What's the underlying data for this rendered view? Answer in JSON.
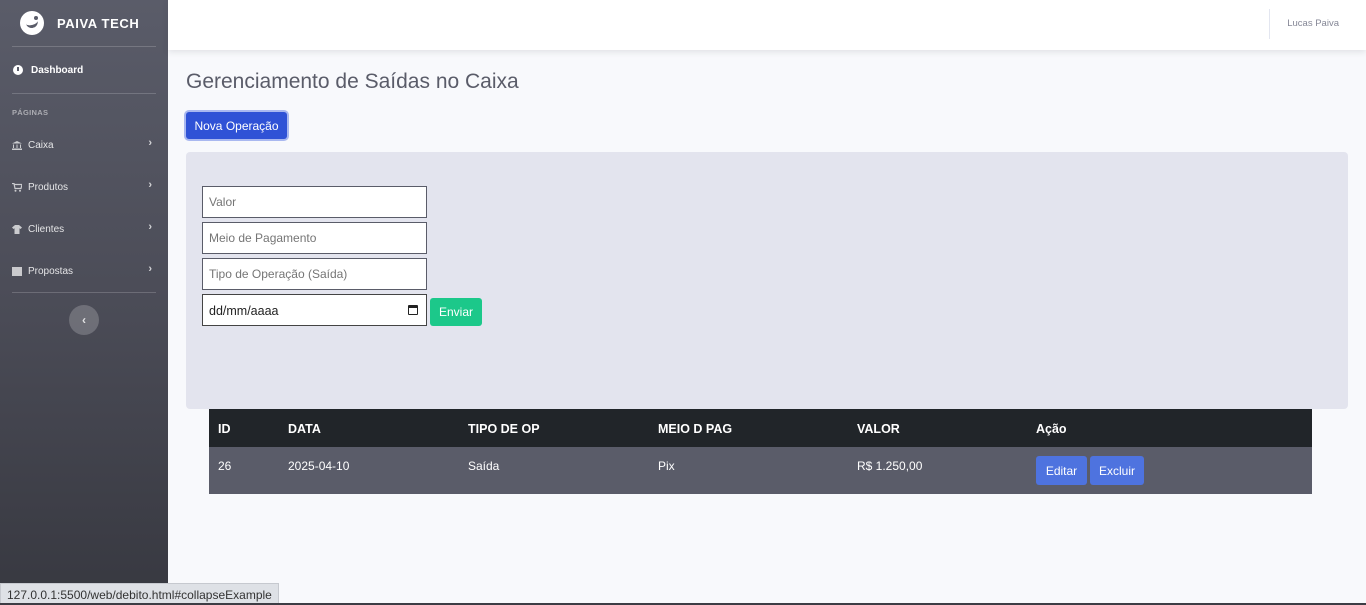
{
  "brand": {
    "name": "PAIVA TECH",
    "icon": "laugh-wink-icon"
  },
  "sidebar": {
    "dashboard": {
      "label": "Dashboard",
      "icon": "tachometer-icon"
    },
    "heading": "PÁGINAS",
    "items": [
      {
        "label": "Caixa",
        "icon": "university-icon"
      },
      {
        "label": "Produtos",
        "icon": "shopping-cart-icon"
      },
      {
        "label": "Clientes",
        "icon": "shirt-icon"
      },
      {
        "label": "Propostas",
        "icon": "table-icon"
      }
    ],
    "toggle_icon": "chevron-left-icon"
  },
  "topbar": {
    "user": "Lucas Paiva"
  },
  "page": {
    "title": "Gerenciamento de Saídas no Caixa",
    "new_button": "Nova Operação"
  },
  "form": {
    "valor_placeholder": "Valor",
    "meio_placeholder": "Meio de Pagamento",
    "tipo_placeholder": "Tipo de Operação (Saída)",
    "date_placeholder": "dd/mm/aaaa",
    "submit": "Enviar"
  },
  "table": {
    "headers": [
      "ID",
      "DATA",
      "TIPO DE OP",
      "MEIO D PAG",
      "VALOR",
      "Ação"
    ],
    "rows": [
      {
        "id": "26",
        "data": "2025-04-10",
        "tipo": "Saída",
        "meio": "Pix",
        "valor": "R$ 1.250,00",
        "edit": "Editar",
        "delete": "Excluir"
      }
    ]
  },
  "status_bar": {
    "url": "127.0.0.1:5500/web/debito.html#collapseExample"
  },
  "colors": {
    "primary": "#4e73df",
    "success": "#1cc88a",
    "sidebar": "#5a5c69",
    "table_head": "#212529"
  }
}
